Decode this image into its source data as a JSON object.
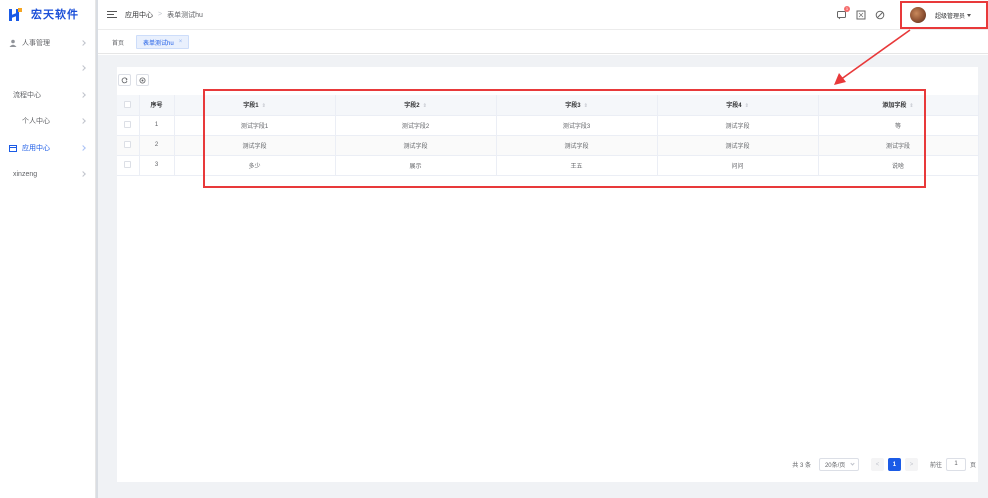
{
  "app": {
    "logo_text": "宏天软件"
  },
  "sidebar": {
    "items": [
      {
        "label": "人事管理",
        "icon": "user-icon",
        "active": false
      },
      {
        "label": "",
        "icon": "",
        "active": false
      },
      {
        "label": "流程中心",
        "icon": "",
        "active": false
      },
      {
        "label": "个人中心",
        "icon": "",
        "active": false
      },
      {
        "label": "应用中心",
        "icon": "calendar-icon",
        "active": true
      },
      {
        "label": "xinzeng",
        "icon": "",
        "active": false
      }
    ]
  },
  "header": {
    "breadcrumb": [
      "应用中心",
      "表单测试hu"
    ],
    "breadcrumb_sep": ">",
    "notification_count": "1",
    "user_name": "超级管理员"
  },
  "tags": {
    "home": "首页",
    "active": "表单测试hu",
    "close_glyph": "×"
  },
  "table": {
    "columns": [
      "序号",
      "字段1",
      "字段2",
      "字段3",
      "字段4",
      "添加字段"
    ],
    "sort_glyph": "⇕",
    "rows": [
      [
        "1",
        "测试字段1",
        "测试字段2",
        "测试字段3",
        "测试字段",
        "等"
      ],
      [
        "2",
        "测试字段",
        "测试字段",
        "测试字段",
        "测试字段",
        "测试字段"
      ],
      [
        "3",
        "多少",
        "展示",
        "王五",
        "问问",
        "说啥"
      ]
    ]
  },
  "pagination": {
    "total": "共 3 条",
    "page_size": "20条/页",
    "current_page": "1",
    "goto_label": "前往",
    "goto_value": "1",
    "page_unit": "页",
    "prev_glyph": "<",
    "next_glyph": ">"
  },
  "colors": {
    "accent": "#1b5be6",
    "highlight": "#e8393a"
  }
}
